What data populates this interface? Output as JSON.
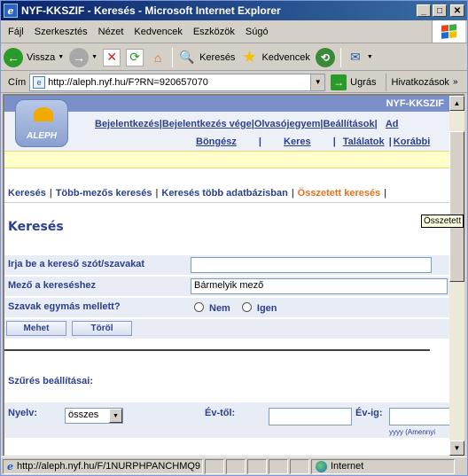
{
  "window": {
    "title": "NYF-KKSZIF - Keresés - Microsoft Internet Explorer",
    "controls": {
      "minimize": "_",
      "maximize": "□",
      "close": "✕"
    }
  },
  "menu": [
    "Fájl",
    "Szerkesztés",
    "Nézet",
    "Kedvencek",
    "Eszközök",
    "Súgó"
  ],
  "toolbar": {
    "back_label": "Vissza",
    "search_label": "Keresés",
    "favorites_label": "Kedvencek"
  },
  "address": {
    "label": "Cím",
    "url": "http://aleph.nyf.hu/F?RN=920657070",
    "go_label": "Ugrás",
    "links_label": "Hivatkozások"
  },
  "page": {
    "library_name": "NYF-KKSZIF",
    "logo_text": "ALEPH",
    "top_links": [
      "Bejelentkezés",
      "Bejelentkezés vége",
      "Olvasójegyem",
      "Beállítások",
      "Ad"
    ],
    "sub_links": [
      "Böngész",
      "Keres",
      "Találatok",
      "Korábbi"
    ],
    "tabs": [
      "Keresés",
      "Több-mezős keresés",
      "Keresés több adatbázisban",
      "Összetett keresés"
    ],
    "active_tab_index": 3,
    "heading": "Keresés",
    "tooltip": "Összetett",
    "form": {
      "query_label": "Irja be a kereső szót/szavakat",
      "query_value": "",
      "field_label": "Mező a kereséshez",
      "field_value": "Bármelyik mező",
      "adjacent_label": "Szavak egymás mellett?",
      "option_no": "Nem",
      "option_yes": "Igen",
      "search_button": "Mehet",
      "clear_button": "Töröl"
    },
    "filters": {
      "heading": "Szűrés beállításai:",
      "language_label": "Nyelv:",
      "language_value": "összes",
      "year_from_label": "Év-től:",
      "year_to_label": "Év-ig:",
      "year_hint": "yyyy (Amennyi"
    }
  },
  "status": {
    "url": "http://aleph.nyf.hu/F/1NURPHPANCHMQ9",
    "zone": "Internet"
  },
  "colors": {
    "link": "#2a3f8f",
    "active_tab": "#e8701a",
    "title_bar": "#0a246a"
  }
}
